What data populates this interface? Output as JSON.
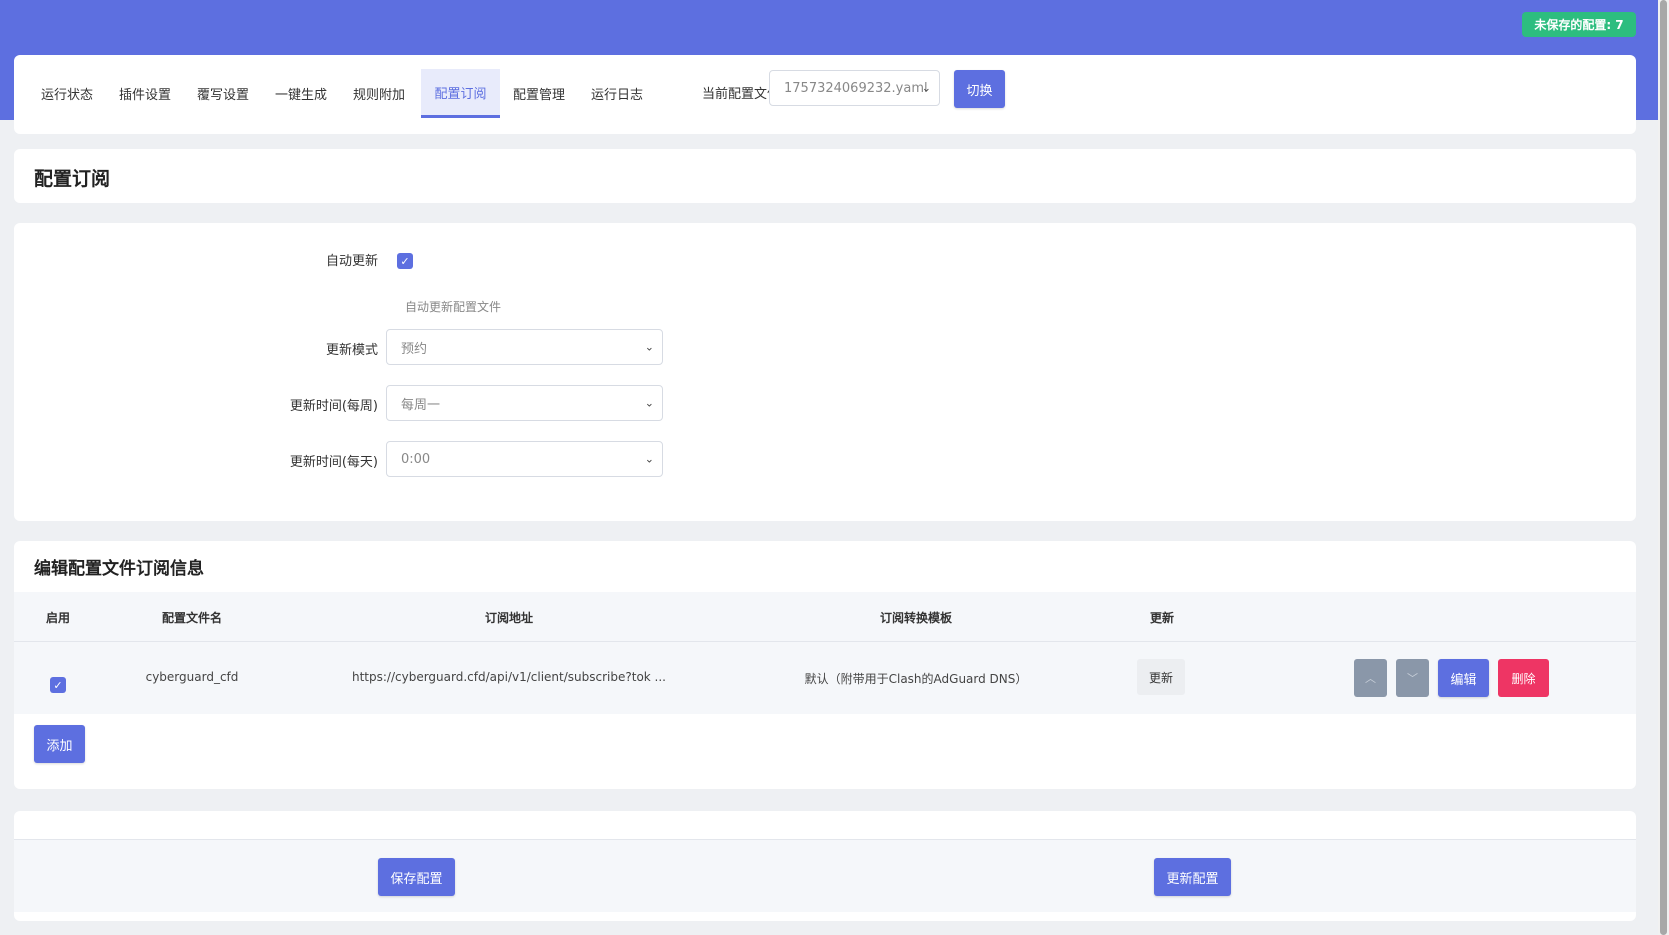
{
  "header": {
    "unsaved_badge": "未保存的配置: 7"
  },
  "nav": {
    "tabs": [
      {
        "label": "运行状态"
      },
      {
        "label": "插件设置"
      },
      {
        "label": "覆写设置"
      },
      {
        "label": "一键生成"
      },
      {
        "label": "规则附加"
      },
      {
        "label": "配置订阅",
        "active": true
      },
      {
        "label": "配置管理"
      },
      {
        "label": "运行日志"
      }
    ],
    "current_config_label": "当前配置文件:",
    "current_config_value": "1757324069232.yaml",
    "switch_button": "切换"
  },
  "page": {
    "title": "配置订阅"
  },
  "form": {
    "auto_update": {
      "label": "自动更新",
      "checked": true,
      "hint": "自动更新配置文件"
    },
    "update_mode": {
      "label": "更新模式",
      "value": "预约"
    },
    "weekly_time": {
      "label": "更新时间(每周)",
      "value": "每周一"
    },
    "daily_time": {
      "label": "更新时间(每天)",
      "value": "0:00"
    }
  },
  "subscriptions": {
    "title": "编辑配置文件订阅信息",
    "columns": [
      "启用",
      "配置文件名",
      "订阅地址",
      "订阅转换模板",
      "更新"
    ],
    "rows": [
      {
        "enabled": true,
        "filename": "cyberguard_cfd",
        "url": "https://cyberguard.cfd/api/v1/client/subscribe?tok ...",
        "template": "默认（附带用于Clash的AdGuard DNS）",
        "update_button": "更新",
        "edit_button": "编辑",
        "delete_button": "删除"
      }
    ],
    "add_button": "添加"
  },
  "footer": {
    "save_button": "保存配置",
    "update_button": "更新配置"
  },
  "colors": {
    "primary": "#5d6fe0",
    "success": "#2dbd7f",
    "danger": "#ee3564",
    "muted": "#8a97a9"
  }
}
